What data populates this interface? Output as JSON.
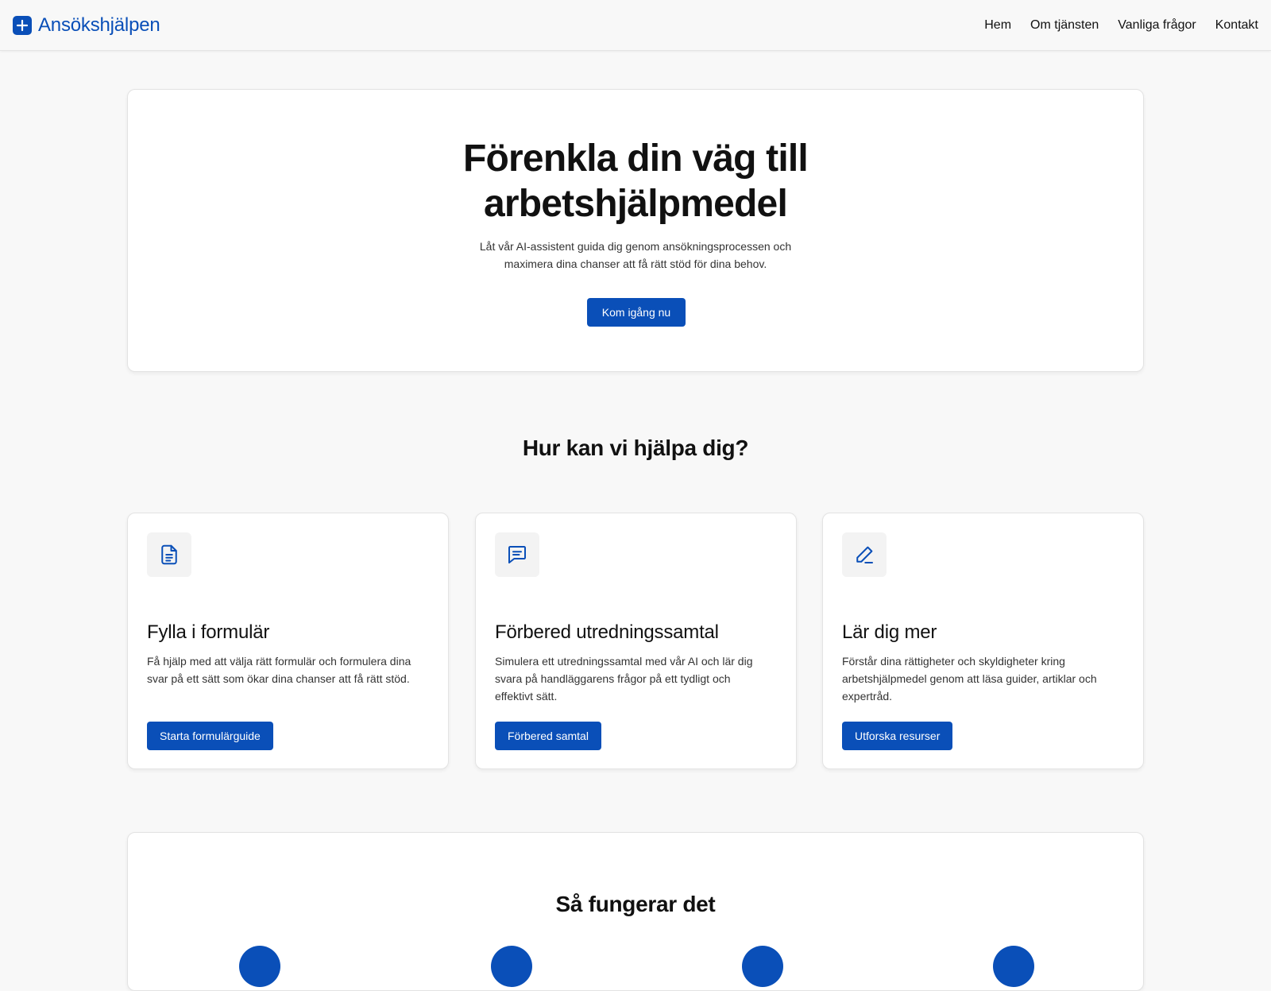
{
  "header": {
    "logo_text": "Ansökshjälpen",
    "nav": [
      "Hem",
      "Om tjänsten",
      "Vanliga frågor",
      "Kontakt"
    ]
  },
  "hero": {
    "title_lines": [
      "Förenkla din väg till",
      "arbetshjälpmedel"
    ],
    "subtitle_lines": [
      "Låt vår AI-assistent guida dig genom ansökningsprocessen och",
      "maximera dina chanser att få rätt stöd för dina behov."
    ],
    "cta": "Kom igång nu"
  },
  "help": {
    "title": "Hur kan vi hjälpa dig?",
    "cards": [
      {
        "icon": "document-icon",
        "title": "Fylla i formulär",
        "text_lines": [
          "Få hjälp med att välja rätt formulär och formulera dina",
          "svar på ett sätt som ökar dina chanser att få rätt stöd."
        ],
        "button": "Starta formulärguide"
      },
      {
        "icon": "chat-icon",
        "title": "Förbered utredningssamtal",
        "text_lines": [
          "Simulera ett utredningssamtal med vår AI och lär dig",
          "svara på handläggarens frågor på ett tydligt och",
          "effektivt sätt."
        ],
        "button": "Förbered samtal"
      },
      {
        "icon": "pen-icon",
        "title": "Lär dig mer",
        "text_lines": [
          "Förstår dina rättigheter och skyldigheter kring",
          "arbetshjälpmedel genom att läsa guider, artiklar och",
          "expertråd."
        ],
        "button": "Utforska resurser"
      }
    ]
  },
  "how": {
    "title": "Så fungerar det"
  },
  "colors": {
    "accent": "#0a4fb8",
    "background": "#f8f8f8",
    "card": "#ffffff"
  }
}
